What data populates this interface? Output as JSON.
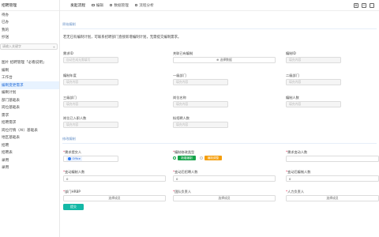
{
  "sidebar": {
    "header": "招聘管理",
    "search_placeholder": "请输入关键字",
    "items": [
      {
        "label": "待办"
      },
      {
        "label": "已办"
      },
      {
        "label": "我的"
      },
      {
        "label": "抄送"
      },
      {
        "label": ""
      },
      {
        "label": "招聘管理"
      },
      {
        "label": "图片 招聘管理「必看说明」"
      },
      {
        "label": "编制"
      },
      {
        "label": "工作台"
      },
      {
        "label": "编制变更需求",
        "active": true
      },
      {
        "label": "编制计划"
      },
      {
        "label": "部门基础表"
      },
      {
        "label": "岗位基础表"
      },
      {
        "label": "需求"
      },
      {
        "label": "招聘需求"
      },
      {
        "label": "岗位行情（AI）基础表"
      },
      {
        "label": "地区基础表"
      },
      {
        "label": "招聘"
      },
      {
        "label": "招聘表"
      },
      {
        "label": "录用"
      },
      {
        "label": "录用"
      }
    ]
  },
  "topbar": {
    "title": "发起流程",
    "actions": [
      {
        "label": "编辑"
      },
      {
        "label": "数据管理"
      },
      {
        "label": "流程分析"
      }
    ]
  },
  "section1": {
    "title": "原始编制"
  },
  "notice": "若无已有编制计划，可联系招聘部门直接新增编制计划，无需提交编制需求。",
  "fields1": {
    "req_id_label": "需求ID",
    "req_id_placeholder": "自动生成无需填写",
    "existing_label": "关联已有编制",
    "existing_button": "⊕ 选择数据",
    "plan_id_label": "编制ID",
    "plan_id_placeholder": "填充内容",
    "year_label": "编制年度",
    "year_placeholder": "填充内容",
    "dept1_label": "一级部门",
    "dept1_placeholder": "填充内容",
    "dept2_label": "二级部门",
    "dept2_placeholder": "填充内容",
    "dept3_label": "三级部门",
    "dept3_placeholder": "填充内容",
    "post_label": "岗位名称",
    "post_placeholder": "填充内容",
    "count_label": "编制人数",
    "count_placeholder": "填充内容",
    "onboard_label": "岗位已入职人数",
    "onboard_placeholder": "填充内容",
    "pending_label": "拟招聘人数",
    "pending_placeholder": "填充内容"
  },
  "section2": {
    "title": "修改编制"
  },
  "fields2": {
    "submitter_label": "需求提交人",
    "submitter_value": "Office",
    "change_type_label": "编制修改类型",
    "change_type_option1": "新增编制",
    "change_type_option2": "编制调整",
    "reason_label": "需求变动人数",
    "total_label": "变动编制人数",
    "total_value": "0",
    "after_label": "变动后招聘人数",
    "after_value": "0",
    "after2_label": "变动后编制人数",
    "after2_value": "0",
    "hrbp_label": "部门HRBP",
    "hrbp_button": "选择成员",
    "leader_label": "团队负责人",
    "leader_button": "选择成员",
    "hr_label": "人力负责人",
    "hr_button": "选择成员"
  },
  "submit_label": "提交",
  "colors": {
    "accent": "#14b8a6",
    "active_bg": "#e8f3ff",
    "radio_green": "#16a34a",
    "orange": "#f59e0b"
  }
}
